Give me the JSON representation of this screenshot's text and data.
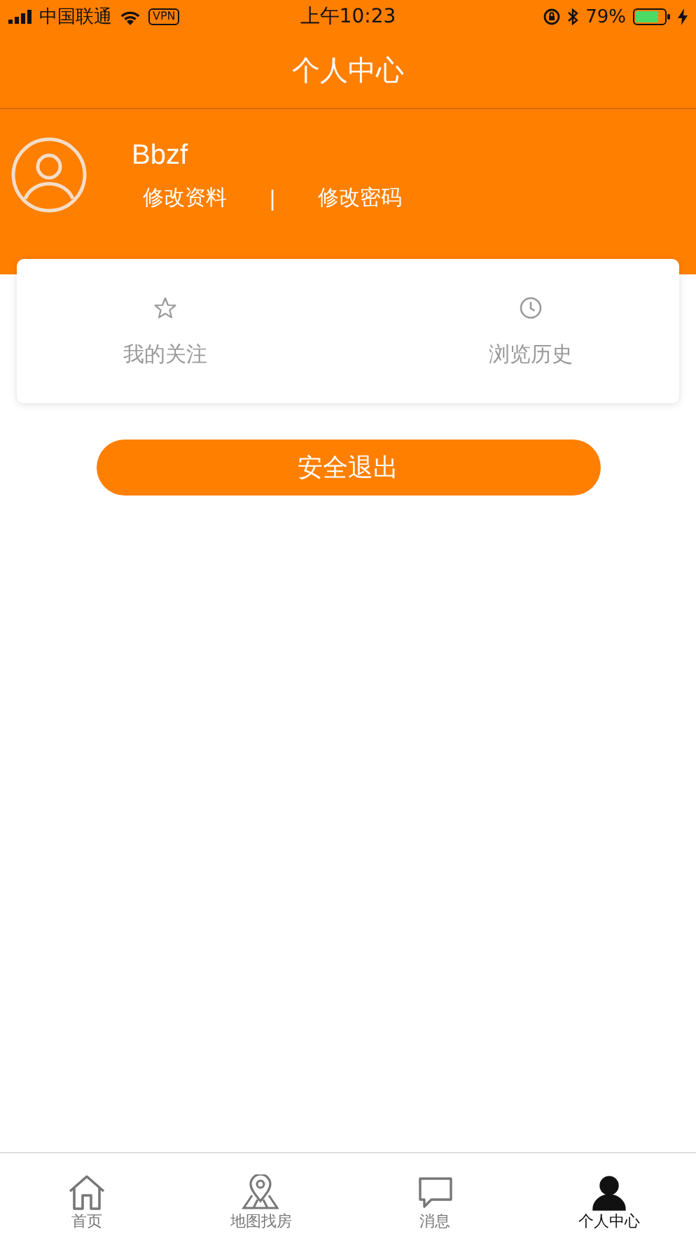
{
  "status_bar": {
    "carrier": "中国联通",
    "vpn": "VPN",
    "time": "上午10:23",
    "battery_percent": "79%"
  },
  "header": {
    "title": "个人中心"
  },
  "profile": {
    "name": "Bbzf",
    "links": [
      "修改资料",
      "修改密码"
    ],
    "separator": "|"
  },
  "shortcuts": [
    {
      "kind": "star",
      "label": "我的关注"
    },
    {
      "kind": "clock",
      "label": "浏览历史"
    }
  ],
  "logout_button": "安全退出",
  "tab_bar": [
    {
      "kind": "home",
      "label": "首页",
      "selected": false
    },
    {
      "kind": "map",
      "label": "地图找房",
      "selected": false
    },
    {
      "kind": "message",
      "label": "消息",
      "selected": false
    },
    {
      "kind": "person",
      "label": "个人中心",
      "selected": true
    }
  ]
}
